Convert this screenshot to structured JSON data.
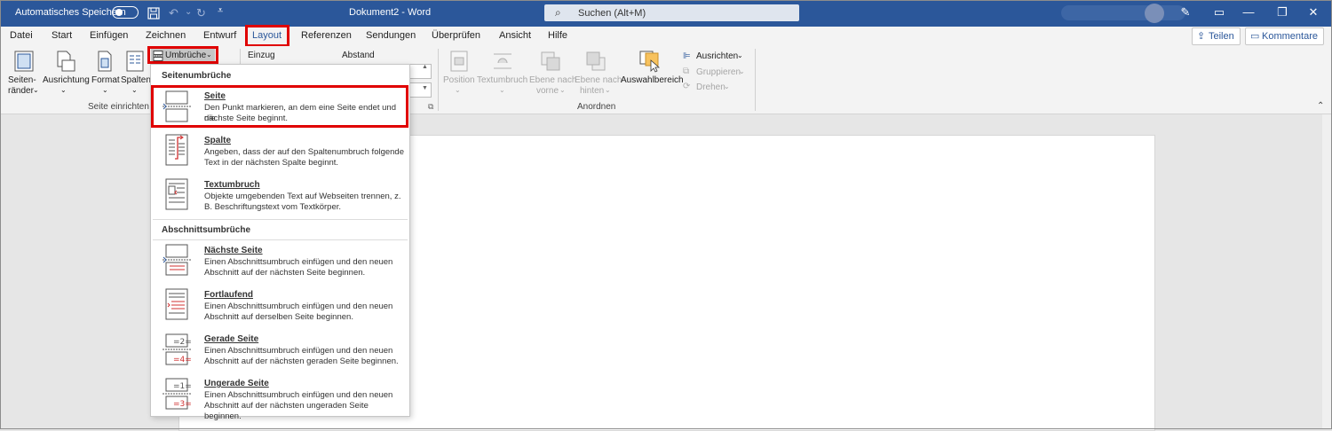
{
  "titlebar": {
    "autosave_label": "Automatisches Speichern",
    "doc_title": "Dokument2  -  Word",
    "search_placeholder": "Suchen (Alt+M)",
    "accent": "#2b579a"
  },
  "tabs": [
    "Datei",
    "Start",
    "Einfügen",
    "Zeichnen",
    "Entwurf",
    "Layout",
    "Referenzen",
    "Sendungen",
    "Überprüfen",
    "Ansicht",
    "Hilfe"
  ],
  "active_tab": "Layout",
  "share_label": "Teilen",
  "comments_label": "Kommentare",
  "ribbon": {
    "seitenraender": [
      "Seiten-",
      "ränder"
    ],
    "ausrichtung": "Ausrichtung",
    "format": "Format",
    "spalten": "Spalten",
    "umbrueche": "Umbrüche",
    "seite_einrichten": "Seite einrichten",
    "einzug": "Einzug",
    "abstand": "Abstand",
    "position": "Position",
    "textumbruch": "Textumbruch",
    "ebene_vorne": [
      "Ebene nach",
      "vorne"
    ],
    "ebene_hinten": [
      "Ebene nach",
      "hinten"
    ],
    "auswahlbereich": "Auswahlbereich",
    "ausrichten": "Ausrichten",
    "gruppieren": "Gruppieren",
    "drehen": "Drehen",
    "anordnen": "Anordnen"
  },
  "menu": {
    "section1": "Seitenumbrüche",
    "section2": "Abschnittsumbrüche",
    "items": [
      {
        "title": "Seite",
        "desc1": "Den Punkt markieren, an dem eine Seite endet und die",
        "desc2": "nächste Seite beginnt."
      },
      {
        "title": "Spalte",
        "desc1": "Angeben, dass der auf den Spaltenumbruch folgende",
        "desc2": "Text in der nächsten Spalte beginnt."
      },
      {
        "title": "Textumbruch",
        "desc1": "Objekte umgebenden Text auf Webseiten trennen, z.",
        "desc2": "B. Beschriftungstext vom Textkörper."
      },
      {
        "title": "Nächste Seite",
        "desc1": "Einen Abschnittsumbruch einfügen und den neuen",
        "desc2": "Abschnitt auf der nächsten Seite beginnen."
      },
      {
        "title": "Fortlaufend",
        "desc1": "Einen Abschnittsumbruch einfügen und den neuen",
        "desc2": "Abschnitt auf derselben Seite beginnen."
      },
      {
        "title": "Gerade Seite",
        "desc1": "Einen Abschnittsumbruch einfügen und den neuen",
        "desc2": "Abschnitt auf der nächsten geraden Seite beginnen."
      },
      {
        "title": "Ungerade Seite",
        "desc1": "Einen Abschnittsumbruch einfügen und den neuen",
        "desc2": "Abschnitt auf der nächsten ungeraden Seite beginnen."
      }
    ]
  }
}
